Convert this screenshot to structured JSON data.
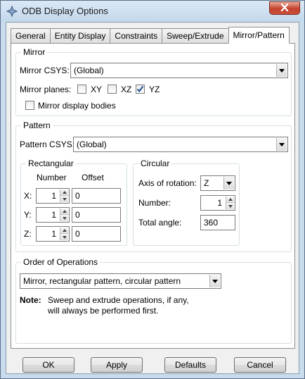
{
  "window": {
    "title": "ODB Display Options"
  },
  "tabs": [
    {
      "label": "General"
    },
    {
      "label": "Entity Display"
    },
    {
      "label": "Constraints"
    },
    {
      "label": "Sweep/Extrude"
    },
    {
      "label": "Mirror/Pattern",
      "active": true
    }
  ],
  "mirror": {
    "title": "Mirror",
    "csys_label": "Mirror CSYS:",
    "csys_value": "(Global)",
    "planes_label": "Mirror planes:",
    "planes": [
      {
        "label": "XY",
        "checked": false
      },
      {
        "label": "XZ",
        "checked": false
      },
      {
        "label": "YZ",
        "checked": true
      }
    ],
    "display_bodies_label": "Mirror display bodies",
    "display_bodies_checked": false
  },
  "pattern": {
    "title": "Pattern",
    "csys_label": "Pattern CSYS:",
    "csys_value": "(Global)",
    "rectangular": {
      "title": "Rectangular",
      "number_header": "Number",
      "offset_header": "Offset",
      "rows": [
        {
          "axis": "X:",
          "number": "1",
          "offset": "0"
        },
        {
          "axis": "Y:",
          "number": "1",
          "offset": "0"
        },
        {
          "axis": "Z:",
          "number": "1",
          "offset": "0"
        }
      ]
    },
    "circular": {
      "title": "Circular",
      "axis_label": "Axis of rotation:",
      "axis_value": "Z",
      "number_label": "Number:",
      "number_value": "1",
      "angle_label": "Total angle:",
      "angle_value": "360"
    }
  },
  "order": {
    "title": "Order of Operations",
    "value": "Mirror, rectangular pattern, circular pattern",
    "note_label": "Note:",
    "note_line1": "Sweep and extrude operations, if any,",
    "note_line2": "will always be performed first."
  },
  "buttons": {
    "ok": "OK",
    "apply": "Apply",
    "defaults": "Defaults",
    "cancel": "Cancel"
  },
  "colors": {
    "checkmark": "#1d4b8f",
    "close_button": "#c6412c"
  }
}
